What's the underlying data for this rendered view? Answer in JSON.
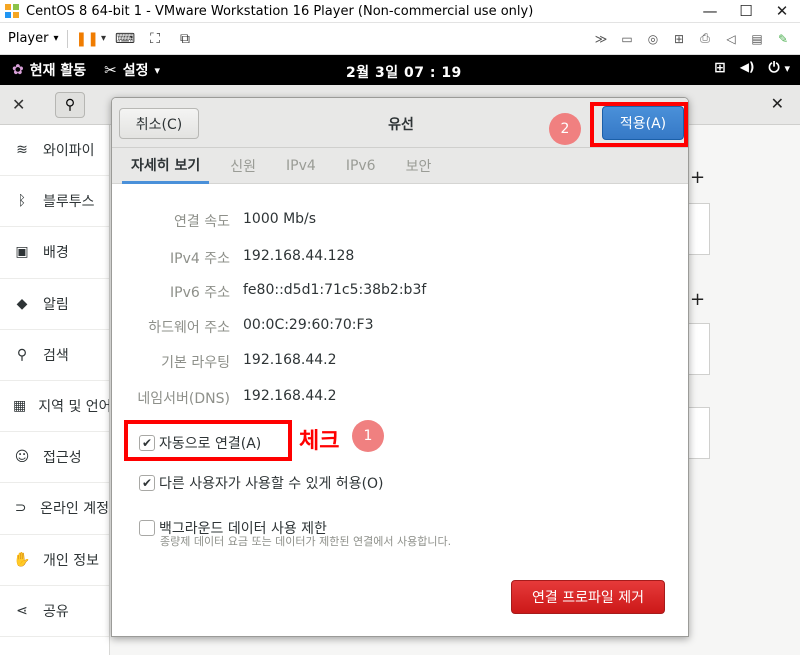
{
  "window": {
    "title": "CentOS 8 64-bit 1 - VMware Workstation 16 Player (Non-commercial use only)",
    "controls": {
      "minimize": "—",
      "maximize": "☐",
      "close": "✕"
    }
  },
  "vmware_toolbar": {
    "player_label": "Player",
    "player_caret": "▾",
    "pause_glyph": "❚❚",
    "caret_glyph": "▾",
    "icons": {
      "send-keys": "⌨",
      "fullscreen": "⛶",
      "unity": "⧉",
      "forward": "≫",
      "hdd": "▭",
      "cd": "◎",
      "network": "⊞",
      "printer": "⎙",
      "sound": "◁",
      "usb": "▤",
      "notes": "✎"
    }
  },
  "gnome_bar": {
    "activities": "현재 활동",
    "app_menu": "설정",
    "app_caret": "▾",
    "clock": "2월 3일  07 : 19",
    "icons": {
      "network": "⊞",
      "volume": "◀)",
      "power": "⏻"
    },
    "power_caret": "▾"
  },
  "settings_header": {
    "tools_glyph": "✕",
    "search_glyph": "⚲",
    "close_glyph": "✕"
  },
  "sidebar": {
    "items": [
      {
        "label": "와이파이",
        "icon": "wifi-icon",
        "glyph": "≋"
      },
      {
        "label": "블루투스",
        "icon": "bluetooth-icon",
        "glyph": "ᛒ"
      },
      {
        "label": "배경",
        "icon": "background-icon",
        "glyph": "▣"
      },
      {
        "label": "알림",
        "icon": "bell-icon",
        "glyph": "◆"
      },
      {
        "label": "검색",
        "icon": "search-icon",
        "glyph": "⚲"
      },
      {
        "label": "지역 및 언어",
        "icon": "region-icon",
        "glyph": "▦"
      },
      {
        "label": "접근성",
        "icon": "accessibility-icon",
        "glyph": "☺"
      },
      {
        "label": "온라인 계정",
        "icon": "online-accounts-icon",
        "glyph": "⊃"
      },
      {
        "label": "개인 정보",
        "icon": "privacy-icon",
        "glyph": "✋"
      },
      {
        "label": "공유",
        "icon": "share-icon",
        "glyph": "⋖"
      }
    ]
  },
  "main_background": {
    "plus_glyph": "+"
  },
  "dialog": {
    "title": "유선",
    "cancel_label": "취소(C)",
    "apply_label": "적용(A)",
    "tabs": [
      {
        "label": "자세히 보기",
        "active": true
      },
      {
        "label": "신원",
        "active": false
      },
      {
        "label": "IPv4",
        "active": false
      },
      {
        "label": "IPv6",
        "active": false
      },
      {
        "label": "보안",
        "active": false
      }
    ],
    "details": [
      {
        "label": "연결 속도",
        "value": "1000 Mb/s"
      },
      {
        "label": "IPv4 주소",
        "value": "192.168.44.128"
      },
      {
        "label": "IPv6 주소",
        "value": "fe80::d5d1:71c5:38b2:b3f"
      },
      {
        "label": "하드웨어 주소",
        "value": "00:0C:29:60:70:F3"
      },
      {
        "label": "기본 라우팅",
        "value": "192.168.44.2"
      },
      {
        "label": "네임서버(DNS)",
        "value": "192.168.44.2"
      }
    ],
    "checkboxes": {
      "auto_connect": {
        "label": "자동으로 연결(A)",
        "checked": true,
        "mark": "✔"
      },
      "allow_others": {
        "label": "다른 사용자가 사용할 수 있게 허용(O)",
        "checked": true,
        "mark": "✔"
      },
      "background_limit": {
        "label": "백그라운드 데이터 사용 제한",
        "checked": false,
        "sublabel": "종량제 데이터 요금 또는 데이터가 제한된 연결에서 사용합니다."
      }
    },
    "remove_label": "연결 프로파일 제거"
  },
  "annotations": {
    "badge_1": "1",
    "badge_2": "2",
    "check_text": "체크",
    "highlight_color": "#ff0000"
  },
  "colors": {
    "accent_blue": "#4a90d9",
    "destructive_red": "#cc1818",
    "badge_pink": "#f08080"
  }
}
